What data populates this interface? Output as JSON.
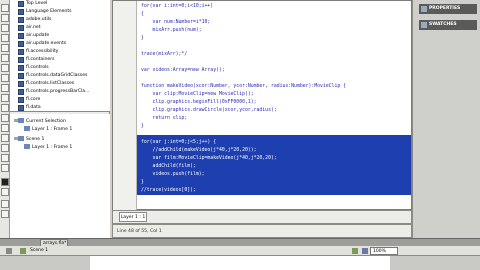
{
  "actions": {
    "items": [
      {
        "label": "Top Level"
      },
      {
        "label": "Language Elements"
      },
      {
        "label": "adobe.utils"
      },
      {
        "label": "air.net"
      },
      {
        "label": "air.update"
      },
      {
        "label": "air.update.events"
      },
      {
        "label": "fl.accessibility"
      },
      {
        "label": "fl.containers"
      },
      {
        "label": "fl.controls"
      },
      {
        "label": "fl.controls.dataGridClasses"
      },
      {
        "label": "fl.controls.listClasses"
      },
      {
        "label": "fl.controls.progressBarCla..."
      },
      {
        "label": "fl.core"
      },
      {
        "label": "fl.data"
      }
    ]
  },
  "tree": {
    "items": [
      {
        "label": "Current Selection"
      },
      {
        "label": "Layer 1 : Frame 1"
      },
      {
        "label": "Scene 1"
      },
      {
        "label": "Layer 1 : Frame 1"
      }
    ]
  },
  "code": {
    "lines": [
      {
        "n": "",
        "t": "for(var i:int=0;i<10;i++)"
      },
      {
        "n": "",
        "t": "{"
      },
      {
        "n": "",
        "t": "    var num:Number=i*10;"
      },
      {
        "n": "",
        "t": "    mixArr.push(num);"
      },
      {
        "n": "",
        "t": "}"
      },
      {
        "n": "",
        "t": ""
      },
      {
        "n": "",
        "t": "trace(mixArr);*/"
      },
      {
        "n": "",
        "t": ""
      },
      {
        "n": "",
        "t": "var videos:Array=new Array();"
      },
      {
        "n": "",
        "t": ""
      },
      {
        "n": "",
        "t": "function makeVideo(xcor:Number, ycor:Number, radius:Number):MovieClip {"
      },
      {
        "n": "",
        "t": "    var clip:MovieClip=new MovieClip();"
      },
      {
        "n": "",
        "t": "    clip.graphics.beginFill(0xFF0000,1);"
      },
      {
        "n": "",
        "t": "    clip.graphics.drawCircle(xcor,ycor,radius);"
      },
      {
        "n": "",
        "t": "    return clip;"
      },
      {
        "n": "",
        "t": "}"
      },
      {
        "n": "",
        "t": ""
      }
    ],
    "selected": [
      {
        "n": "",
        "t": "for(var j:int=0;j<5;j++) {"
      },
      {
        "n": "",
        "t": "    //addChild(makeVideo(j*40,j*20,20));"
      },
      {
        "n": "",
        "t": "    var film:MovieClip=makeVideo(j*40,j*20,20);"
      },
      {
        "n": "",
        "t": "    addChild(film);"
      },
      {
        "n": "",
        "t": "    videos.push(film);"
      },
      {
        "n": "",
        "t": "}"
      },
      {
        "n": "",
        "t": "//trace(videos[0]);"
      },
      {
        "n": "",
        "t": "videos[1].alpha=0.25;"
      }
    ],
    "layer_tab": "Layer 1 : 1",
    "line_info": "Line 48 of 55, Col 1"
  },
  "right": {
    "properties": "PROPERTIES",
    "swatches": "SWATCHES"
  },
  "doc": {
    "tab": "arrays.fla*"
  },
  "scene": {
    "label": "Scene 1",
    "zoom": "100%"
  }
}
